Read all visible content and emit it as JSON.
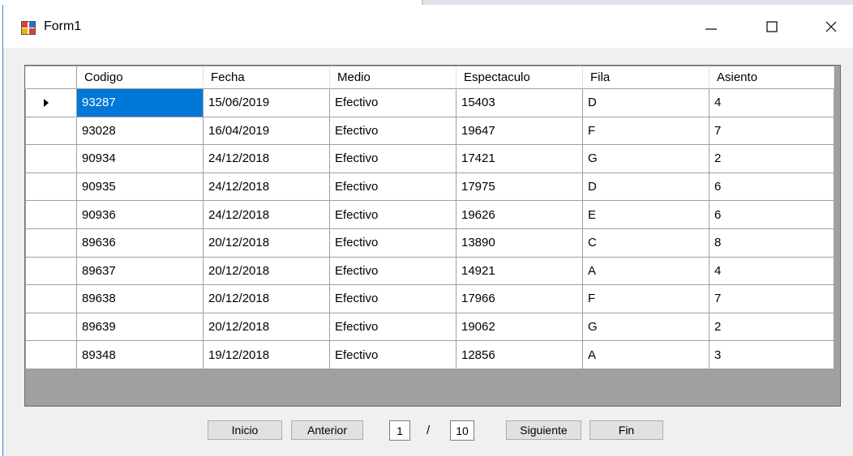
{
  "window": {
    "title": "Form1"
  },
  "grid": {
    "columns": [
      "Codigo",
      "Fecha",
      "Medio",
      "Espectaculo",
      "Fila",
      "Asiento"
    ],
    "rows": [
      [
        "93287",
        "15/06/2019",
        "Efectivo",
        "15403",
        "D",
        "4"
      ],
      [
        "93028",
        "16/04/2019",
        "Efectivo",
        "19647",
        "F",
        "7"
      ],
      [
        "90934",
        "24/12/2018",
        "Efectivo",
        "17421",
        "G",
        "2"
      ],
      [
        "90935",
        "24/12/2018",
        "Efectivo",
        "17975",
        "D",
        "6"
      ],
      [
        "90936",
        "24/12/2018",
        "Efectivo",
        "19626",
        "E",
        "6"
      ],
      [
        "89636",
        "20/12/2018",
        "Efectivo",
        "13890",
        "C",
        "8"
      ],
      [
        "89637",
        "20/12/2018",
        "Efectivo",
        "14921",
        "A",
        "4"
      ],
      [
        "89638",
        "20/12/2018",
        "Efectivo",
        "17966",
        "F",
        "7"
      ],
      [
        "89639",
        "20/12/2018",
        "Efectivo",
        "19062",
        "G",
        "2"
      ],
      [
        "89348",
        "19/12/2018",
        "Efectivo",
        "12856",
        "A",
        "3"
      ]
    ],
    "current_row": 0,
    "selected_col": 0
  },
  "pager": {
    "first_label": "Inicio",
    "prev_label": "Anterior",
    "current_page": "1",
    "separator": "/",
    "total_pages": "10",
    "next_label": "Siguiente",
    "last_label": "Fin"
  },
  "colors": {
    "selection": "#0078d7",
    "grid_background": "#a0a0a0",
    "window_border": "#3a86d6"
  }
}
